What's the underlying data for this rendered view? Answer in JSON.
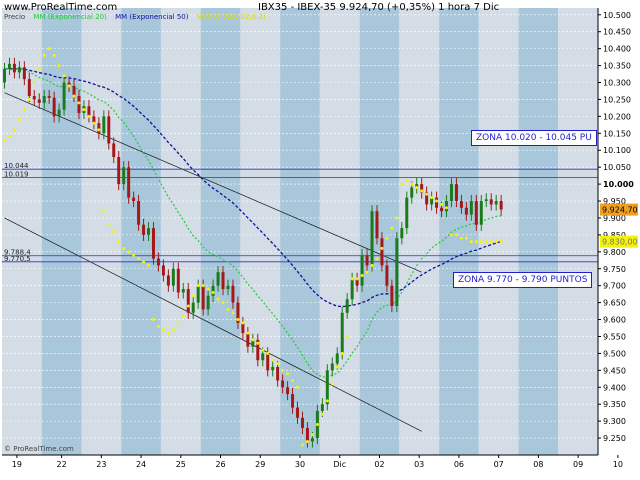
{
  "header": {
    "site": "www.ProRealTime.com",
    "instrument_line": "IBX35 - IBEX-35    9.924,70 (+0,35%)    1 hora  7 Dic"
  },
  "legend": {
    "price": "Precio",
    "mm20": "MM (Exponencial 20)",
    "mm50": "MM (Exponencial 50)",
    "sar": "SAR (0,02;0,02;0,2)"
  },
  "zones": {
    "upper": "ZONA 10.020 - 10.045 PU",
    "lower": "ZONA 9.770 - 9.790 PUNTOS"
  },
  "copyright": "© ProRealTime.com",
  "colors": {
    "up": "#1b7a1b",
    "down": "#a51818",
    "mm20": "#22c93a",
    "mm50": "#10109a",
    "sar": "#f2f20a",
    "hline": "#3030d0",
    "band_light": "#d4dde6",
    "band_dark": "#a8c7da"
  },
  "chart_data": {
    "type": "candlestick",
    "ylim": [
      9200,
      10520
    ],
    "y_ticks": [
      "10.500",
      "10.450",
      "10.400",
      "10.350",
      "10.300",
      "10.250",
      "10.200",
      "10.150",
      "10.100",
      "10.050",
      "10.000",
      "9.950",
      "9.900",
      "9.850",
      "9.800",
      "9.750",
      "9.700",
      "9.650",
      "9.600",
      "9.550",
      "9.500",
      "9.450",
      "9.400",
      "9.350",
      "9.300",
      "9.250"
    ],
    "y_tick_values": [
      10500,
      10450,
      10400,
      10350,
      10300,
      10250,
      10200,
      10150,
      10100,
      10050,
      10000,
      9950,
      9900,
      9850,
      9800,
      9750,
      9700,
      9650,
      9600,
      9550,
      9500,
      9450,
      9400,
      9350,
      9300,
      9250
    ],
    "x_ticks": [
      "19",
      "22",
      "23",
      "24",
      "25",
      "26",
      "29",
      "30",
      "Dic",
      "02",
      "03",
      "06",
      "07",
      "08",
      "09",
      "10"
    ],
    "last_price": "9.924,70",
    "last_price_value": 9924.7,
    "sar_last": "9.830,00",
    "sar_last_value": 9830,
    "hlines": [
      {
        "label": "10.044",
        "value": 10044
      },
      {
        "label": "10.019",
        "value": 10019
      },
      {
        "label": "9.788,4",
        "value": 9788.4
      },
      {
        "label": "9.770,5",
        "value": 9770.5
      }
    ],
    "trendlines": [
      {
        "from": [
          0,
          10270
        ],
        "to": [
          84,
          9740
        ]
      },
      {
        "from": [
          0,
          9900
        ],
        "to": [
          84,
          9270
        ]
      }
    ],
    "close": [
      10340,
      10355,
      10330,
      10345,
      10310,
      10260,
      10250,
      10240,
      10260,
      10255,
      10200,
      10220,
      10300,
      10290,
      10260,
      10210,
      10230,
      10200,
      10180,
      10150,
      10200,
      10120,
      10080,
      10000,
      10050,
      9960,
      9950,
      9880,
      9850,
      9870,
      9780,
      9760,
      9730,
      9700,
      9750,
      9680,
      9690,
      9620,
      9650,
      9700,
      9630,
      9670,
      9700,
      9740,
      9690,
      9700,
      9650,
      9590,
      9560,
      9520,
      9540,
      9480,
      9500,
      9450,
      9460,
      9420,
      9400,
      9380,
      9340,
      9310,
      9280,
      9240,
      9250,
      9330,
      9350,
      9450,
      9470,
      9500,
      9620,
      9660,
      9720,
      9700,
      9790,
      9760,
      9920,
      9840,
      9760,
      9700,
      9640,
      9840,
      9870,
      9960,
      9990,
      10000,
      9975,
      9940,
      9960,
      9930,
      9920,
      9950,
      10000,
      9950,
      9930,
      9910,
      9950,
      9880,
      9950,
      9955,
      9940,
      9950,
      9925
    ],
    "open": [
      10300,
      10340,
      10355,
      10330,
      10345,
      10310,
      10260,
      10250,
      10240,
      10260,
      10255,
      10200,
      10220,
      10300,
      10290,
      10260,
      10210,
      10230,
      10200,
      10180,
      10150,
      10200,
      10120,
      10080,
      10000,
      10050,
      9960,
      9950,
      9880,
      9850,
      9870,
      9780,
      9760,
      9730,
      9700,
      9750,
      9680,
      9690,
      9620,
      9650,
      9700,
      9630,
      9670,
      9700,
      9740,
      9690,
      9700,
      9650,
      9590,
      9560,
      9520,
      9540,
      9480,
      9500,
      9450,
      9460,
      9420,
      9400,
      9380,
      9340,
      9310,
      9280,
      9240,
      9250,
      9330,
      9350,
      9450,
      9470,
      9500,
      9620,
      9660,
      9720,
      9700,
      9790,
      9760,
      9920,
      9840,
      9760,
      9700,
      9640,
      9840,
      9870,
      9960,
      9990,
      10000,
      9975,
      9940,
      9960,
      9930,
      9920,
      9950,
      10000,
      9950,
      9930,
      9910,
      9950,
      9880,
      9950,
      9955,
      9940,
      9950
    ],
    "sar": [
      10130,
      10140,
      10160,
      10190,
      10220,
      10250,
      10300,
      10340,
      10380,
      10400,
      10380,
      10350,
      10320,
      10290,
      10260,
      10240,
      10220,
      10200,
      10180,
      10160,
      9920,
      9880,
      9860,
      9830,
      9810,
      9800,
      9790,
      9780,
      9770,
      9760,
      9600,
      9580,
      9570,
      9560,
      9570,
      9590,
      9610,
      9640,
      9670,
      9700,
      9700,
      9690,
      9680,
      9660,
      9650,
      9630,
      9620,
      9600,
      9590,
      9560,
      9540,
      9530,
      9510,
      9500,
      9480,
      9470,
      9450,
      9440,
      9420,
      9400,
      9230,
      9240,
      9260,
      9290,
      9320,
      9360,
      9410,
      9460,
      9500,
      9550,
      9720,
      9720,
      9730,
      9740,
      9760,
      9780,
      9810,
      9840,
      9870,
      9900,
      10000,
      10010,
      10000,
      9990,
      9980,
      9970,
      9960,
      9950,
      9940,
      9930,
      9850,
      9850,
      9840,
      9840,
      9830,
      9830,
      9830,
      9830,
      9830,
      9830,
      9830
    ],
    "x_label_index": [
      3,
      12,
      20,
      28,
      36,
      44,
      52,
      60,
      68,
      76,
      84,
      92,
      100,
      108,
      116,
      124
    ]
  }
}
